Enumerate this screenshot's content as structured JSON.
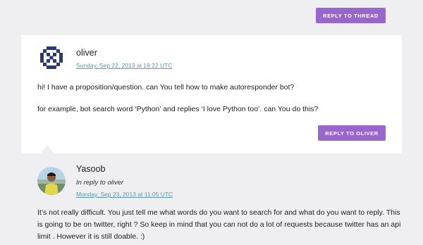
{
  "thread": {
    "reply_to_thread_label": "Reply to thread"
  },
  "comments": [
    {
      "author": "oliver",
      "date": "Sunday, Sep 22, 2013 at 19:22 UTC",
      "paragraphs": [
        "hi! I have a proposition/question. can You tell how to make autoresponder bot?",
        "for example, bot search word ‘Python’ and replies ‘I love Python too’. can You do this?"
      ],
      "reply_label": "Reply to oliver",
      "avatar_icon": "identicon-avatar",
      "avatar_color": "#2c3a73"
    },
    {
      "author": "Yasoob",
      "in_reply_to": "In reply to oliver",
      "date": "Monday, Sep 23, 2013 at 11:05 UTC",
      "paragraphs": [
        "It’s not really difficult. You just tell me what words do you want to search for and what do you want to reply. This",
        "is going to be on twitter, right ? So keep in mind that you can not do a lot of requests because twitter has an api",
        "limit . However it is still doable. :)"
      ],
      "avatar_icon": "profile-photo-avatar"
    }
  ],
  "colors": {
    "accent": "#9966cc",
    "link": "#5a9aa8",
    "grey_background": "#efeef1"
  }
}
